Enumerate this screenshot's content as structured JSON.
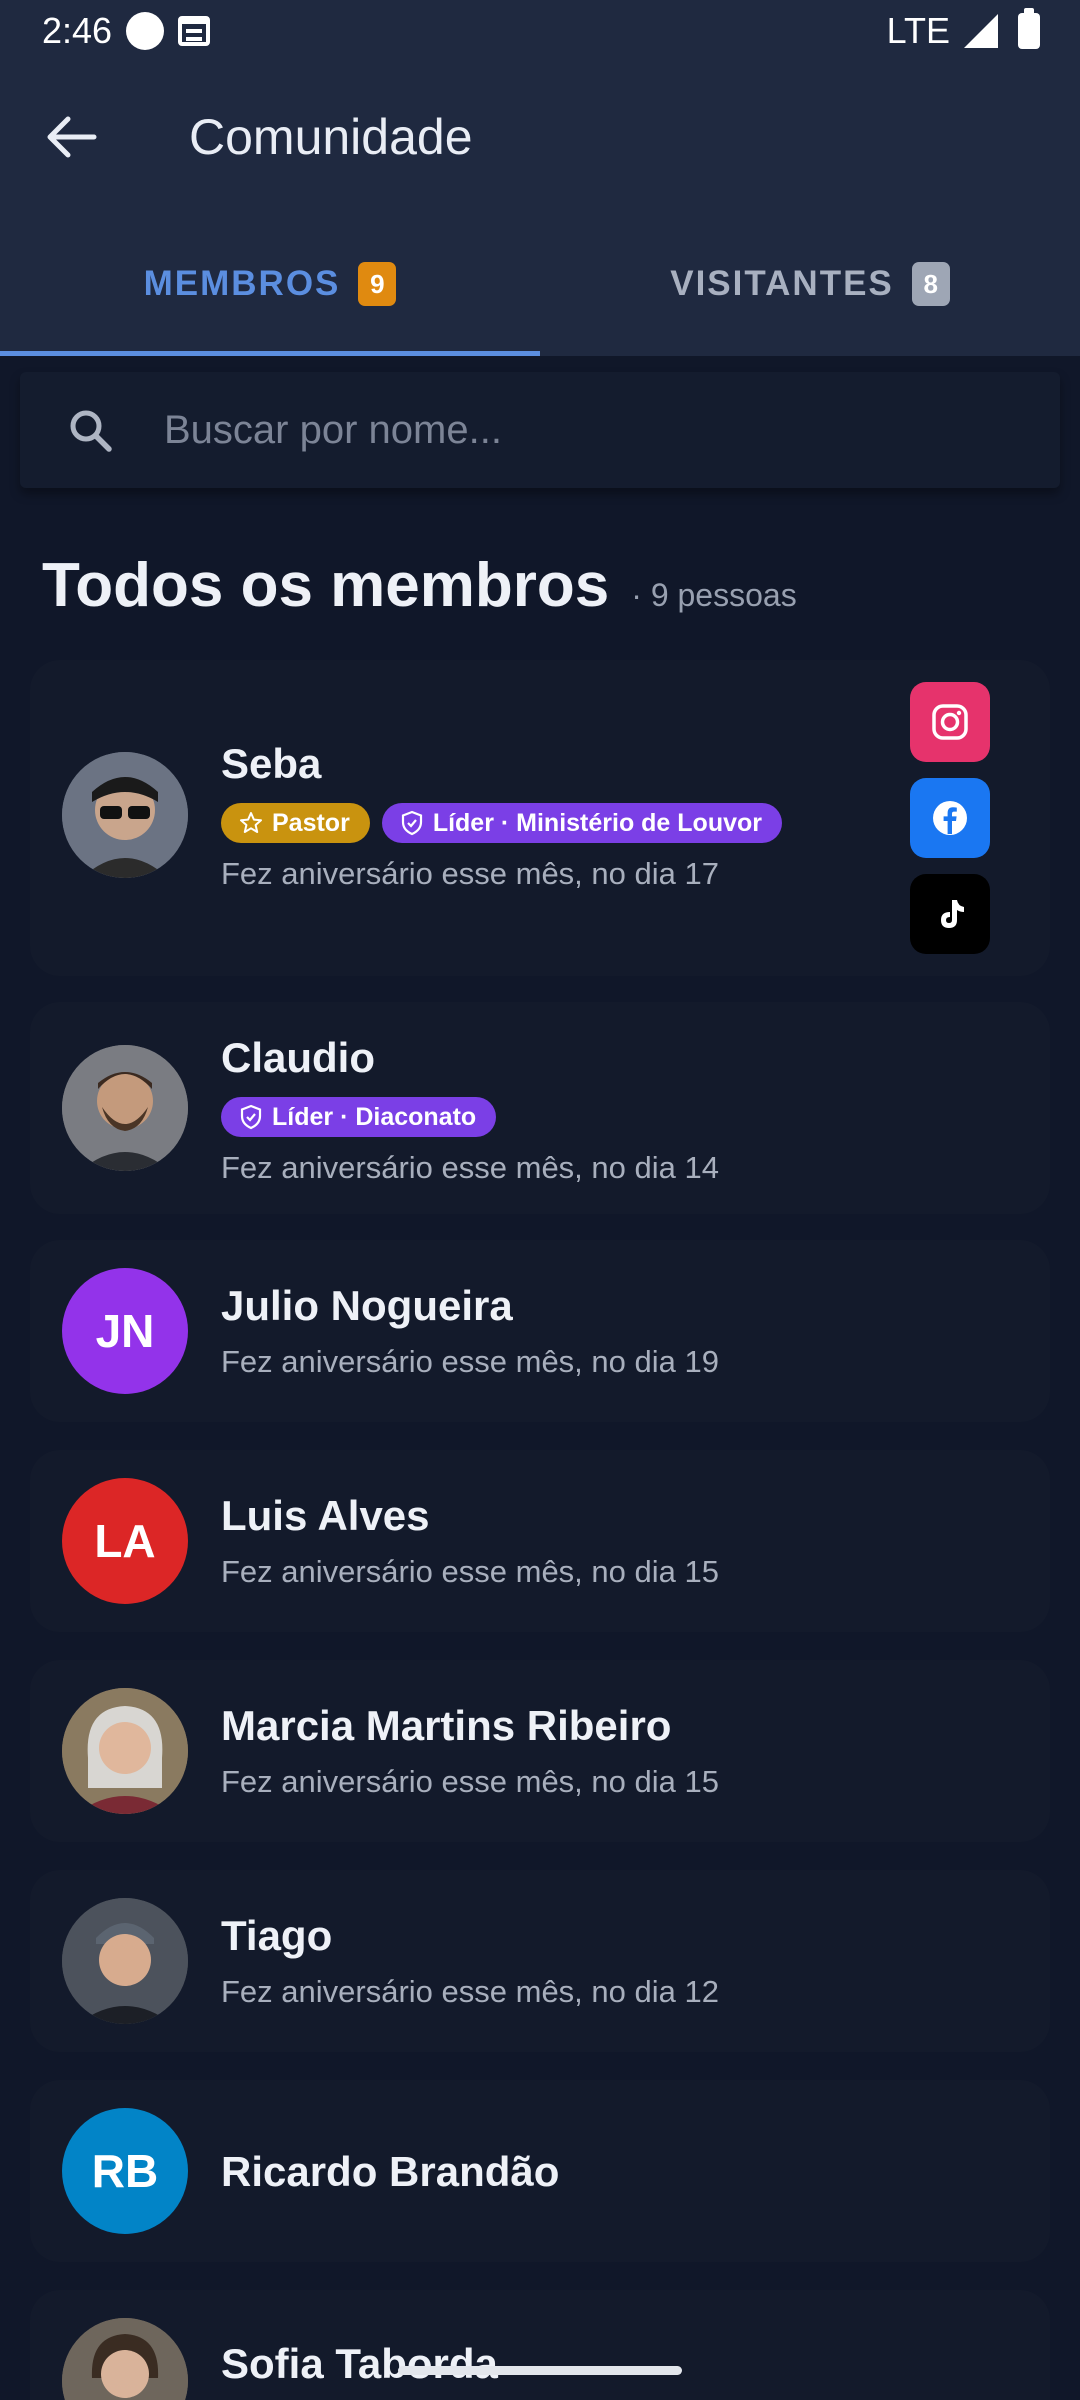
{
  "status_bar": {
    "time": "2:46",
    "network": "LTE"
  },
  "app_bar": {
    "title": "Comunidade"
  },
  "tabs": [
    {
      "label": "MEMBROS",
      "count": "9",
      "selected": true
    },
    {
      "label": "VISITANTES",
      "count": "8",
      "selected": false
    }
  ],
  "search": {
    "placeholder": "Buscar por nome...",
    "value": ""
  },
  "section": {
    "title": "Todos os membros",
    "count_text": "· 9 pessoas"
  },
  "members": [
    {
      "name": "Seba",
      "badges": [
        {
          "label": "Pastor",
          "icon": "star-icon"
        },
        {
          "label": "Líder · Ministério de Louvor",
          "icon": "shield-icon"
        }
      ],
      "birthday": "Fez aniversário esse mês, no dia 17",
      "avatar": "photo",
      "social": [
        "instagram-icon",
        "facebook-icon",
        "tiktok-icon"
      ]
    },
    {
      "name": "Claudio",
      "badges": [
        {
          "label": "Líder · Diaconato",
          "icon": "shield-icon"
        }
      ],
      "birthday": "Fez aniversário esse mês, no dia 14",
      "avatar": "photo"
    },
    {
      "name": "Julio Nogueira",
      "initials": "JN",
      "avatar_color": "#9333ea",
      "birthday": "Fez aniversário esse mês, no dia 19"
    },
    {
      "name": "Luis Alves",
      "initials": "LA",
      "avatar_color": "#dc2626",
      "birthday": "Fez aniversário esse mês, no dia 15"
    },
    {
      "name": "Marcia Martins Ribeiro",
      "avatar": "photo",
      "birthday": "Fez aniversário esse mês, no dia 15"
    },
    {
      "name": "Tiago",
      "avatar": "photo",
      "birthday": "Fez aniversário esse mês, no dia 12"
    },
    {
      "name": "Ricardo Brandão",
      "initials": "RB",
      "avatar_color": "#0284c7"
    },
    {
      "name": "Sofia Taborda",
      "avatar": "photo"
    }
  ],
  "colors": {
    "background": "#101729",
    "header": "#1f2940",
    "accent": "#5b8ee0",
    "pastor_badge": "#c9930f",
    "leader_badge": "#7b3fe6"
  }
}
